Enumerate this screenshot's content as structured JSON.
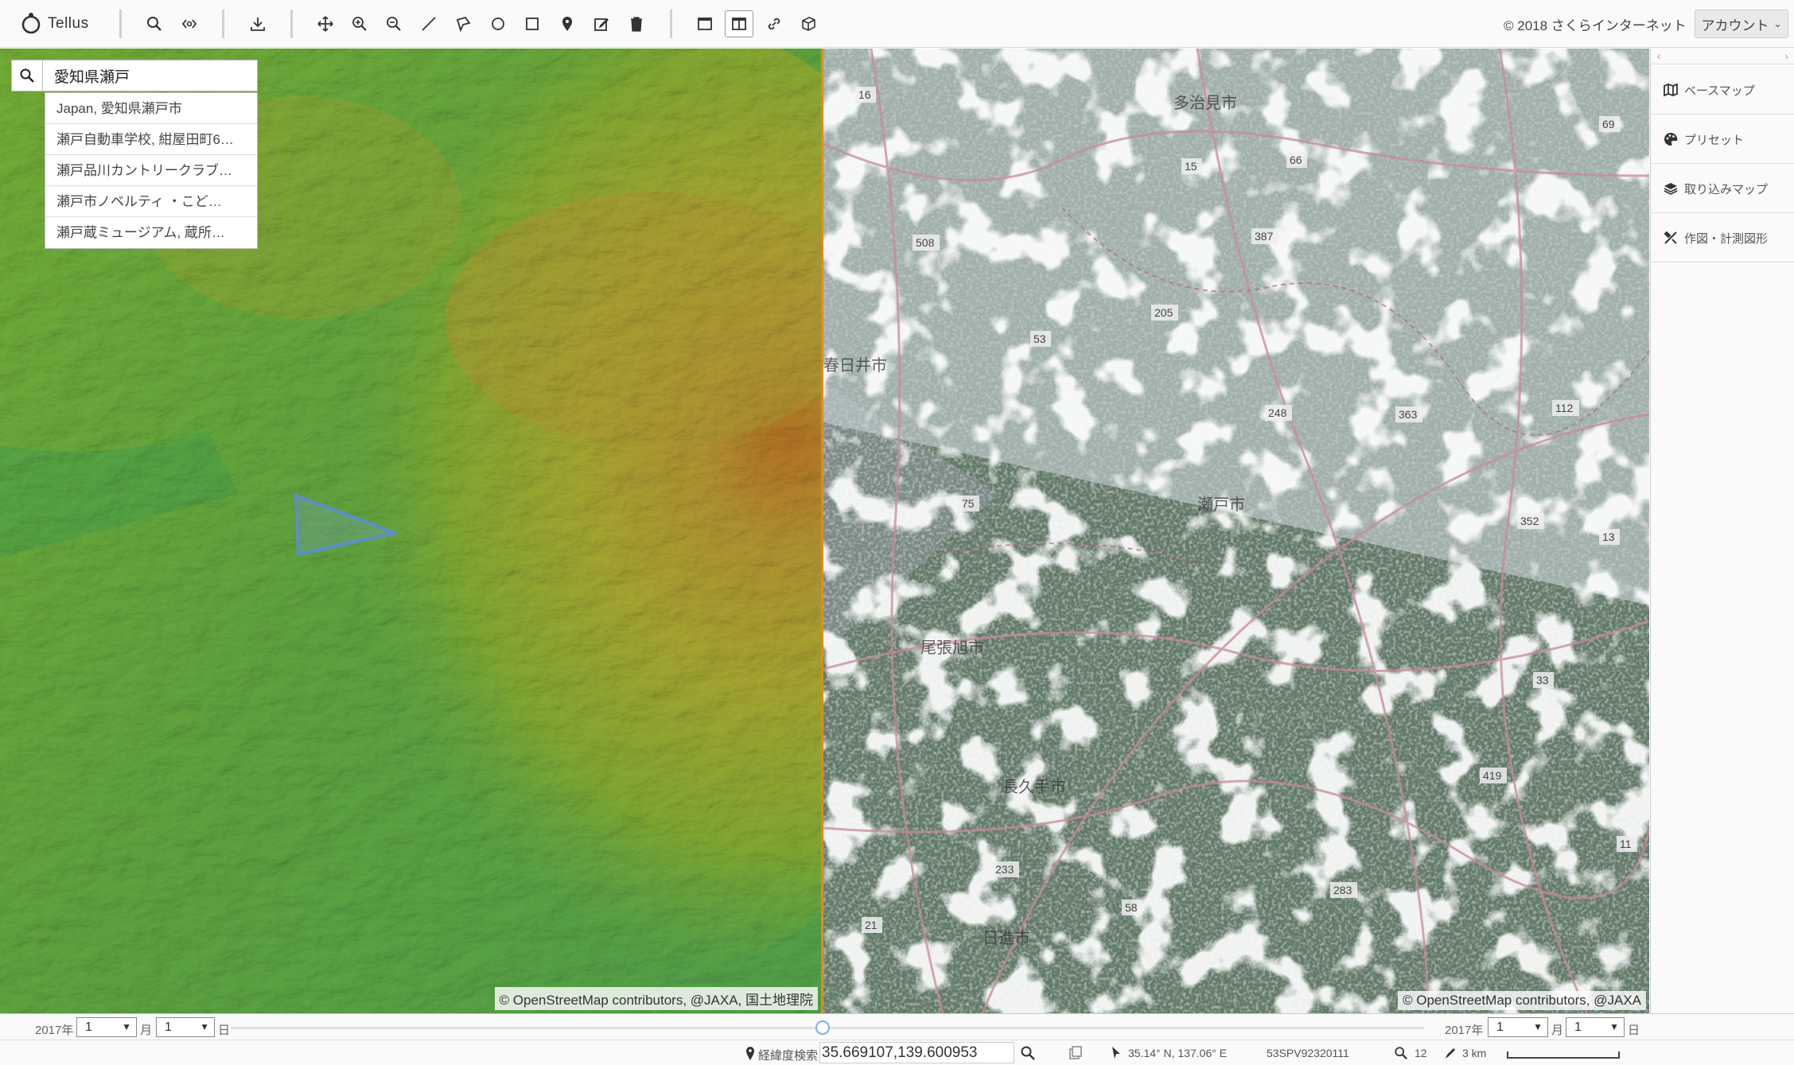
{
  "app": {
    "name": "Tellus"
  },
  "header": {
    "copyright": "© 2018 さくらインターネット",
    "account_label": "アカウント",
    "tools": [
      "search-icon",
      "link-icon",
      "download-icon",
      "pan-icon",
      "zoom-in-icon",
      "zoom-out-icon",
      "line-icon",
      "polygon-icon",
      "circle-icon",
      "rectangle-icon",
      "marker-icon",
      "edit-icon",
      "delete-icon",
      "single-view-icon",
      "split-view-icon",
      "sync-link-icon",
      "3d-icon"
    ]
  },
  "search": {
    "value": "愛知県瀬戸",
    "suggestions": [
      "Japan, 愛知県瀬戸市",
      "瀬戸自動車学校, 紺屋田町6…",
      "瀬戸品川カントリークラブ…",
      "瀬戸市ノベルティ ・こど…",
      "瀬戸蔵ミュージアム, 蔵所…"
    ]
  },
  "left_map": {
    "attribution": "© OpenStreetMap contributors, @JAXA, 国土地理院"
  },
  "right_map": {
    "attribution": "© OpenStreetMap contributors, @JAXA",
    "labels": [
      {
        "id": "city-a",
        "text": "尾張旭市"
      },
      {
        "id": "city-b",
        "text": "日進市"
      },
      {
        "id": "city-c",
        "text": "長久手市"
      },
      {
        "id": "city-d",
        "text": "瀬戸市"
      },
      {
        "id": "city-e",
        "text": "春日井市"
      },
      {
        "id": "city-f",
        "text": "多治見市"
      }
    ],
    "route_numbers": [
      "16",
      "15",
      "66",
      "69",
      "508",
      "387",
      "53",
      "205",
      "248",
      "363",
      "112",
      "352",
      "13",
      "75",
      "33",
      "419",
      "283",
      "233",
      "58",
      "11",
      "21",
      "248"
    ]
  },
  "panel": {
    "items": [
      {
        "label": "ベースマップ",
        "icon": "map-icon"
      },
      {
        "label": "プリセット",
        "icon": "palette-icon"
      },
      {
        "label": "取り込みマップ",
        "icon": "layers-icon"
      },
      {
        "label": "作図・計測図形",
        "icon": "tools-icon"
      }
    ]
  },
  "timebar": {
    "left": {
      "year": "2017年",
      "month": "1",
      "month_unit": "月",
      "day": "1",
      "day_unit": "日"
    },
    "right": {
      "year": "2017年",
      "month": "1",
      "month_unit": "月",
      "day": "1",
      "day_unit": "日"
    }
  },
  "status": {
    "coord_search_label": "経緯度検索",
    "coord_value": "35.669107,139.600953",
    "cursor_coord": "35.14° N, 137.06° E",
    "mesh_code": "53SPV92320111",
    "zoom": "12",
    "scale": "3 km"
  }
}
